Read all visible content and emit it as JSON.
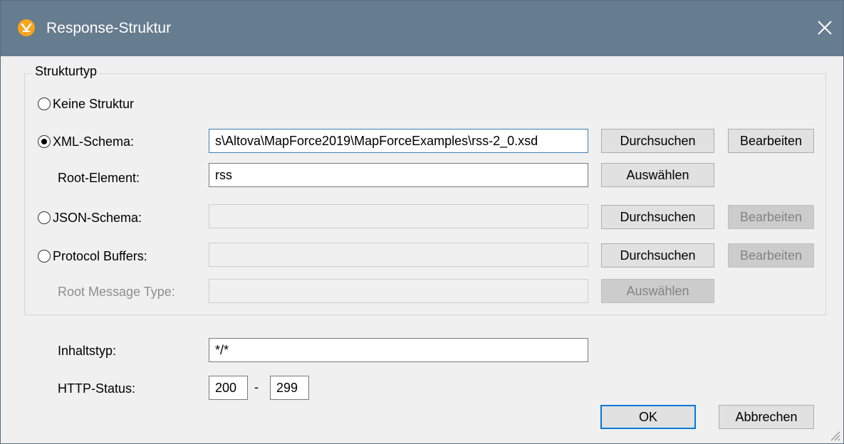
{
  "window": {
    "title": "Response-Struktur"
  },
  "structure_group": {
    "legend": "Strukturtyp",
    "options": {
      "none": {
        "label": "Keine Struktur",
        "selected": false
      },
      "xml": {
        "label": "XML-Schema:",
        "selected": true,
        "path_value": "s\\Altova\\MapForce2019\\MapForceExamples\\rss-2_0.xsd",
        "browse": "Durchsuchen",
        "edit": "Bearbeiten"
      },
      "xml_root": {
        "label": "Root-Element:",
        "value": "rss",
        "select": "Auswählen"
      },
      "json": {
        "label": "JSON-Schema:",
        "selected": false,
        "path_value": "",
        "browse": "Durchsuchen",
        "edit": "Bearbeiten"
      },
      "protobuf": {
        "label": "Protocol Buffers:",
        "selected": false,
        "path_value": "",
        "browse": "Durchsuchen",
        "edit": "Bearbeiten"
      },
      "protobuf_root": {
        "label": "Root Message Type:",
        "value": "",
        "select": "Auswählen"
      }
    }
  },
  "content_type": {
    "label": "Inhaltstyp:",
    "value": "*/*"
  },
  "http_status": {
    "label": "HTTP-Status:",
    "from": "200",
    "separator": "-",
    "to": "299"
  },
  "buttons": {
    "ok": "OK",
    "cancel": "Abbrechen"
  },
  "icons": {
    "app": "mapforce-logo-icon",
    "close": "close-icon",
    "grip": "resize-grip-icon"
  },
  "colors": {
    "titlebar": "#667c8f",
    "app_icon": "#f7a41d",
    "focus_border": "#0078d7"
  }
}
